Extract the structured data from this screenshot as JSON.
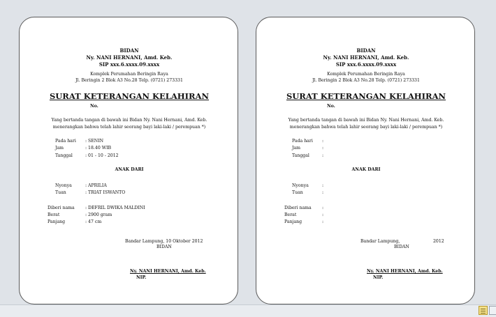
{
  "letter": {
    "header": {
      "role": "BIDAN",
      "name": "Ny. NANI HERNANI, Amd. Keb.",
      "sip": "SIP xxx.6.xxxx.09.xxxx",
      "address1": "Komplek Perumahan Beringin Raya",
      "address2": "Jl. Beringin 2 Blok A3 No.28 Telp. (0721) 273331"
    },
    "title": "SURAT KETERANGAN KELAHIRAN",
    "number_label": "No.",
    "intro1": "Yang bertanda tangan di bawah ini Bidan Ny. Nani Hernani, Amd. Keb.",
    "intro2": "menerangkan bahwa telah lahir seorang bayi laki-laki / perempuan *)",
    "labels": {
      "pada_hari": "Pada hari",
      "jam": "Jam",
      "tanggal": "Tanggal",
      "anak_dari": "ANAK DARI",
      "nyonya": "Nyonya",
      "tuan": "Tuan",
      "diberi_nama": "Diberi nama",
      "berat": "Berat",
      "panjang": "Panjang",
      "bidan": "BIDAN",
      "nip": "NIP."
    }
  },
  "filled": {
    "pada_hari": ": SENIN",
    "jam": ": 18.40 WIB",
    "tanggal": ": 01 - 10 - 2012",
    "nyonya": ": APRILIA",
    "tuan": ": TRIAT ISWANTO",
    "diberi_nama": ": DEFRIL DWIKA MALDINI",
    "berat": ": 2900 gram",
    "panjang": ": 47 cm",
    "place_date": "Bandar Lampung, 10 Oktober 2012",
    "signer": "Ny. NANI HERNANI, Amd. Keb."
  },
  "blank": {
    "colon": ":",
    "place": "Bandar Lampung,",
    "year": "2012",
    "signer": "Ny. NANI HERNANI, Amd. Keb."
  }
}
